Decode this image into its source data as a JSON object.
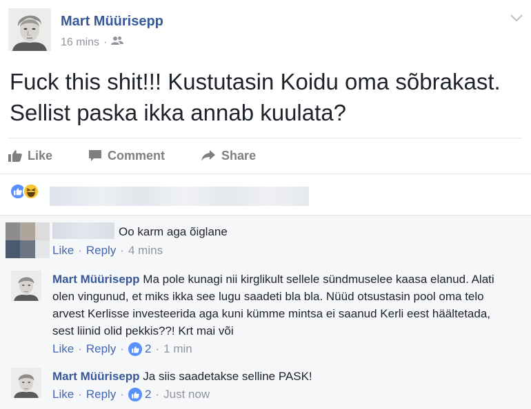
{
  "post": {
    "author": "Mart Müürisepp",
    "time": "16 mins",
    "meta_sep": "·",
    "privacy_icon": "friends-icon",
    "text": "Fuck this shit!!! Kustutasin Koidu oma sõbrakast. Sellist paska ikka annab kuulata?",
    "menu_icon": "chevron-down-icon"
  },
  "actions": {
    "like": "Like",
    "comment": "Comment",
    "share": "Share"
  },
  "reactions": {
    "types": [
      "like",
      "haha"
    ],
    "colors": {
      "like": "#5890ff",
      "haha": "#f7c533"
    }
  },
  "comments": [
    {
      "author": "",
      "text": "Oo karm aga õiglane",
      "like_label": "Like",
      "reply_label": "Reply",
      "time": "4 mins"
    },
    {
      "author": "Mart Müürisepp",
      "text": "Ma pole kunagi nii kirglikult sellele sündmuselee kaasa elanud. Alati olen vingunud, et miks ikka see lugu saadeti bla bla. Nüüd otsustasin pool oma telo arvest Kerlisse investeerida aga kuni kümme mintsa ei saanud Kerli eest häältetada, sest liinid olid pekkis??! Krt mai või",
      "like_label": "Like",
      "reply_label": "Reply",
      "reactions": "2",
      "time": "1 min"
    },
    {
      "author": "Mart Müürisepp",
      "text": "Ja siis saadetakse selline PASK!",
      "like_label": "Like",
      "reply_label": "Reply",
      "reactions": "2",
      "time": "Just now"
    }
  ],
  "colors": {
    "name_blue": "#365899",
    "link_blue": "#4267b2",
    "meta_gray": "#90949c",
    "comments_bg": "#f6f7f9"
  }
}
